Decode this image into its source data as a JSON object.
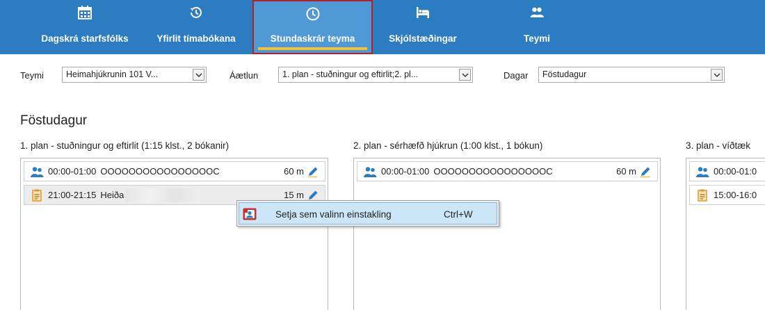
{
  "ribbon": {
    "tabs": [
      {
        "label": "Dagskrá starfsfólks",
        "icon": "calendar-icon"
      },
      {
        "label": "Yfirlit tímabókana",
        "icon": "history-icon"
      },
      {
        "label": "Stundaskrár teyma",
        "icon": "clock-icon",
        "active": true
      },
      {
        "label": "Skjólstæðingar",
        "icon": "bed-icon"
      },
      {
        "label": "Teymi",
        "icon": "team-icon"
      }
    ],
    "colors": {
      "background": "#2b7cc0",
      "active": "#4f9ad6",
      "active_border": "#b22222",
      "underline": "#f2c230"
    }
  },
  "filters": {
    "team_label": "Teymi",
    "team_value": "Heimahjúkrunin 101 V...",
    "plan_label": "Áætlun",
    "plan_value": "1. plan - stuðningur og eftirlit;2. pl...",
    "days_label": "Dagar",
    "days_value": "Föstudagur"
  },
  "day_title": "Föstudagur",
  "plans": [
    {
      "heading": "1. plan - stuðningur og eftirlit (1:15 klst., 2 bókanir)",
      "bookings": [
        {
          "icon": "group-icon",
          "time": "00:00-01:00",
          "name": "OOOOOOOOOOOOOOOOC",
          "duration": "60 m"
        },
        {
          "icon": "clipboard-icon",
          "time": "21:00-21:15",
          "name": "Heiða",
          "duration": "15 m"
        }
      ]
    },
    {
      "heading": "2. plan - sérhæfð hjúkrun (1:00 klst., 1 bókun)",
      "bookings": [
        {
          "icon": "group-icon",
          "time": "00:00-01:00",
          "name": "OOOOOOOOOOOOOOOOC",
          "duration": "60 m"
        }
      ]
    },
    {
      "heading": "3. plan - víðtæk",
      "bookings": [
        {
          "icon": "group-icon",
          "time": "00:00-01:0"
        },
        {
          "icon": "clipboard-icon",
          "time": "15:00-16:0"
        }
      ]
    }
  ],
  "context_menu": {
    "item_label": "Setja sem valinn einstakling",
    "shortcut": "Ctrl+W",
    "icon": "person-select-icon"
  }
}
